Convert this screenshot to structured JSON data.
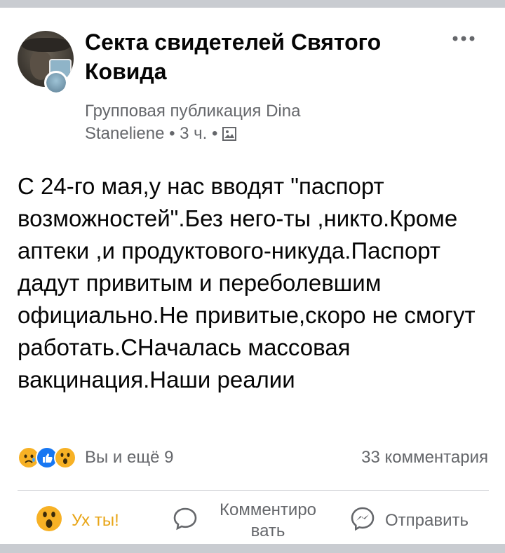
{
  "post": {
    "group_name": "Секта свидетелей Святого Ковида",
    "meta_line": "Групповая публикация Dina Staneliene • 3 ч. •",
    "more_icon": "ellipsis-icon",
    "privacy_icon": "photo-icon",
    "text": "С 24-го мая,у нас вводят \"паспорт возможностей\".Без него-ты ,никто.Кроме аптеки ,и продуктового-никуда.Паспорт дадут привитым и переболевшим официально.Не привитые,скоро не смогут работать.СНачалась массовая вакцинация.Наши реалии"
  },
  "reactions": {
    "icons": [
      "sad-reaction-icon",
      "like-reaction-icon",
      "wow-reaction-icon"
    ],
    "summary": "Вы и ещё 9",
    "comments": "33 комментария"
  },
  "actions": {
    "wow_label": "Ух ты!",
    "comment_label": "Комментиро вать",
    "share_label": "Отправить"
  },
  "colors": {
    "text_primary": "#050505",
    "text_secondary": "#65676b",
    "like_blue": "#1877f2",
    "wow_yellow": "#f7b125",
    "background": "#c9ccd1"
  }
}
